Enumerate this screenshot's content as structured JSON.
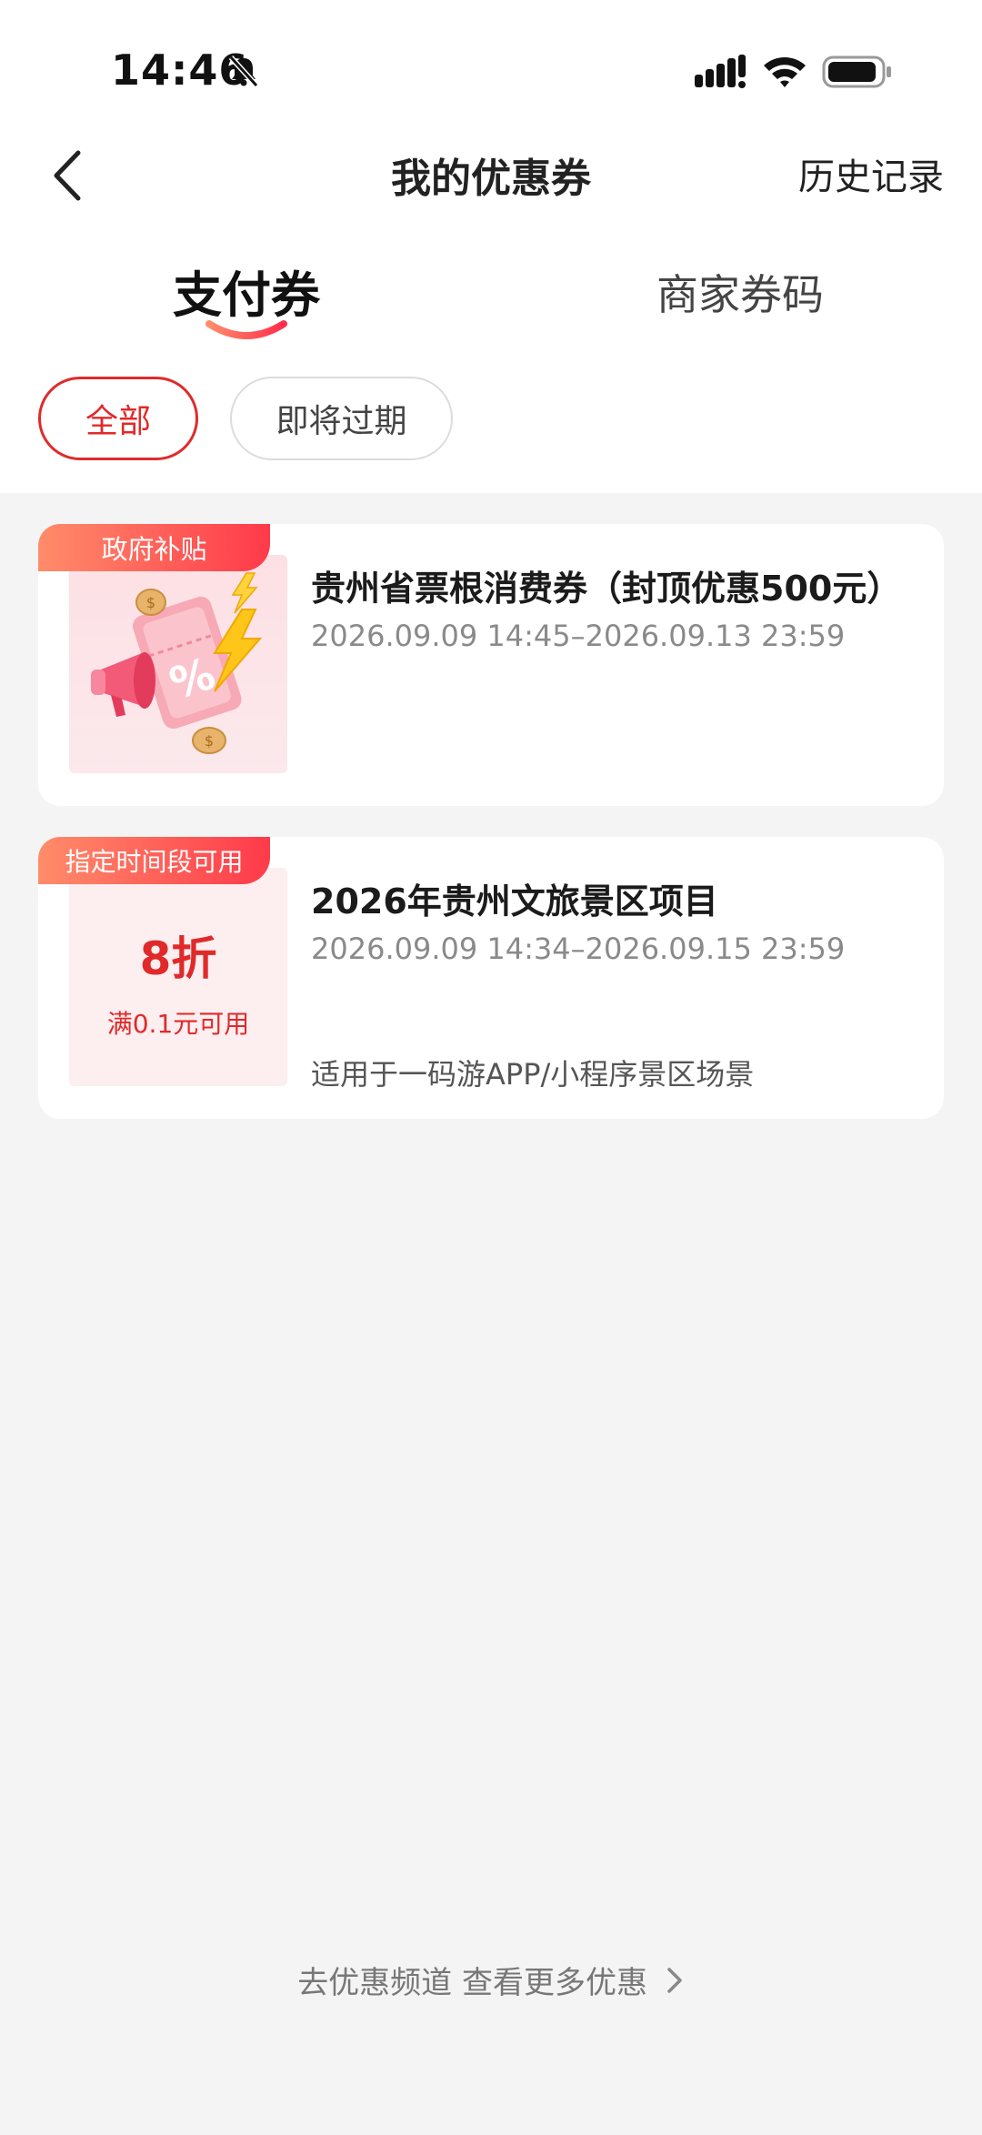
{
  "status_bar": {
    "time": "14:46"
  },
  "nav": {
    "title": "我的优惠券",
    "history": "历史记录"
  },
  "tabs": [
    {
      "label": "支付券",
      "active": true
    },
    {
      "label": "商家券码",
      "active": false
    }
  ],
  "filters": [
    {
      "label": "全部",
      "selected": true
    },
    {
      "label": "即将过期",
      "selected": false
    }
  ],
  "coupons": [
    {
      "tag": "政府补贴",
      "title": "贵州省票根消费券（封顶优惠500元）",
      "date_range": "2026.09.09 14:45–2026.09.13 23:59",
      "thumbnail": "megaphone-percent-ticket-illustration"
    },
    {
      "tag": "指定时间段可用",
      "title": "2026年贵州文旅景区项目",
      "date_range": "2026.09.09 14:34–2026.09.15 23:59",
      "discount": "8折",
      "condition": "满0.1元可用",
      "note": "适用于一码游APP/小程序景区场景"
    }
  ],
  "footer": {
    "link": "去优惠频道 查看更多优惠"
  },
  "colors": {
    "accent": "#e02a2a",
    "tag_gradient_start": "#ff8c6a",
    "tag_gradient_end": "#ff3a4a",
    "background": "#f4f4f4"
  }
}
